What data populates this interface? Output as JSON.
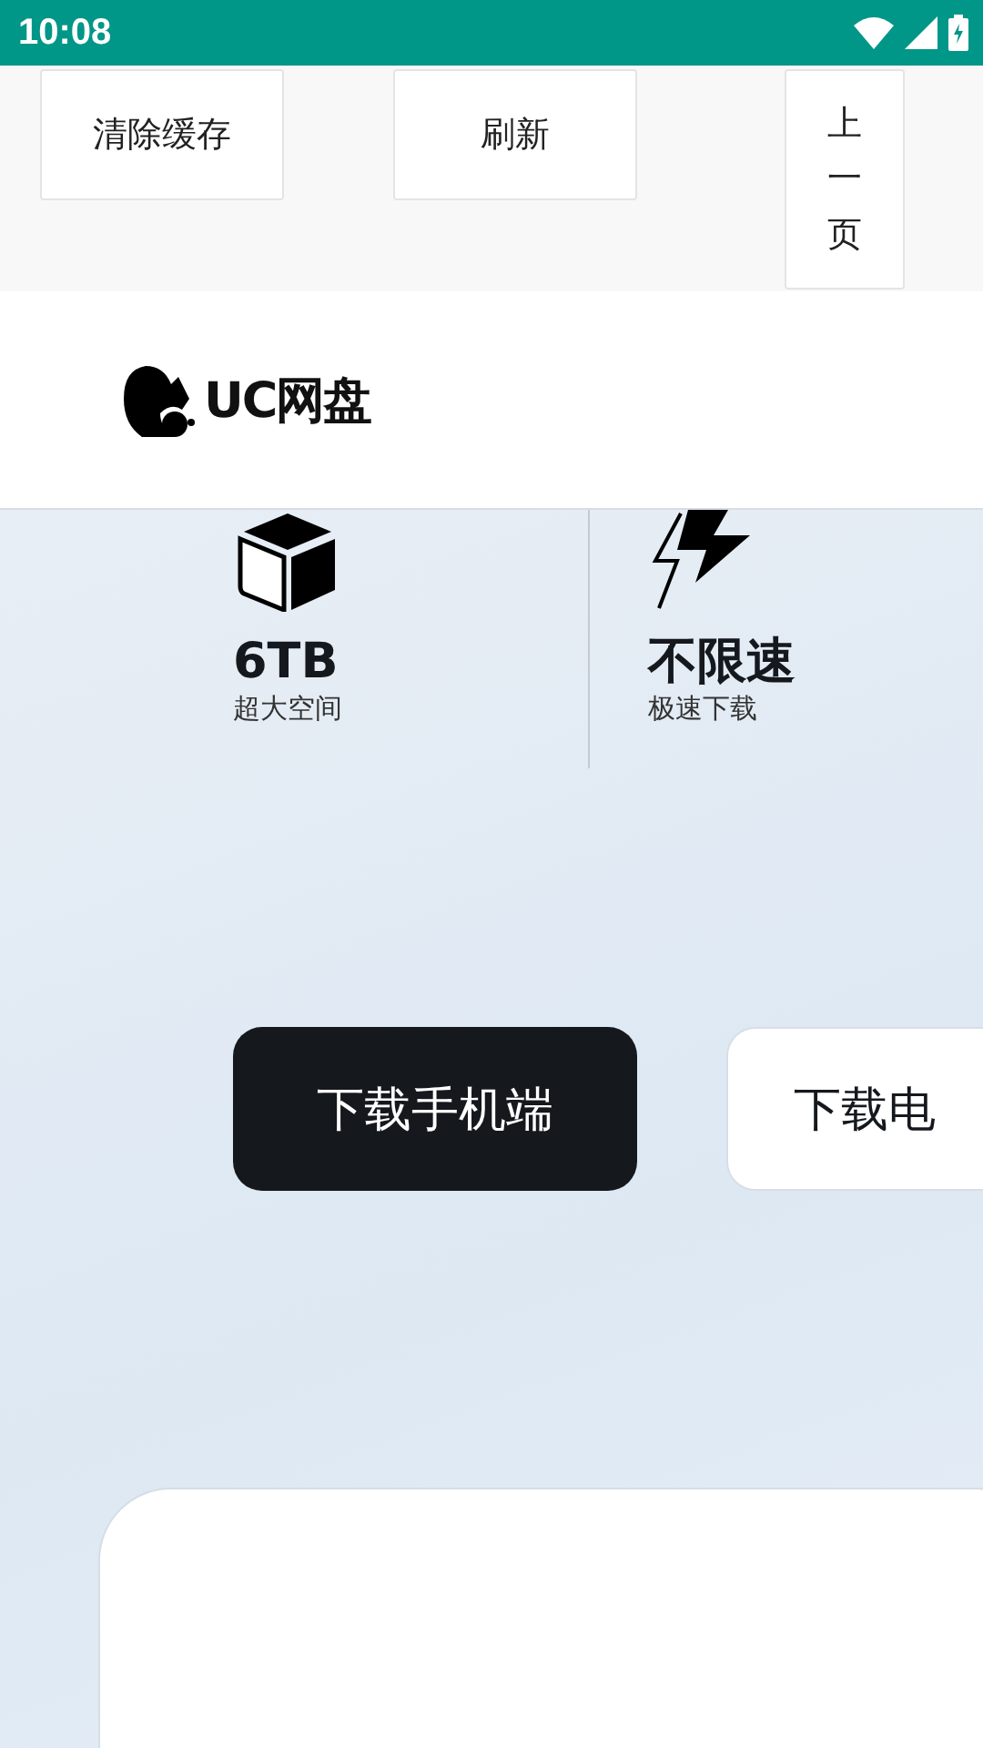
{
  "status_bar": {
    "time": "10:08"
  },
  "toolbar": {
    "buttons": [
      {
        "label": "清除缓存",
        "kind": "wide"
      },
      {
        "label": "刷新",
        "kind": "wide"
      },
      {
        "label": "上一页",
        "kind": "vertical"
      }
    ]
  },
  "header": {
    "logo_text": "UC网盘"
  },
  "features": [
    {
      "kind": "cube",
      "value": "6TB",
      "caption": "超大空间"
    },
    {
      "kind": "bolt",
      "value": "不限速",
      "caption": "极速下载"
    }
  ],
  "downloads": [
    {
      "label": "下载手机端",
      "kind": "primary"
    },
    {
      "label": "下载电",
      "kind": "secondary"
    }
  ]
}
